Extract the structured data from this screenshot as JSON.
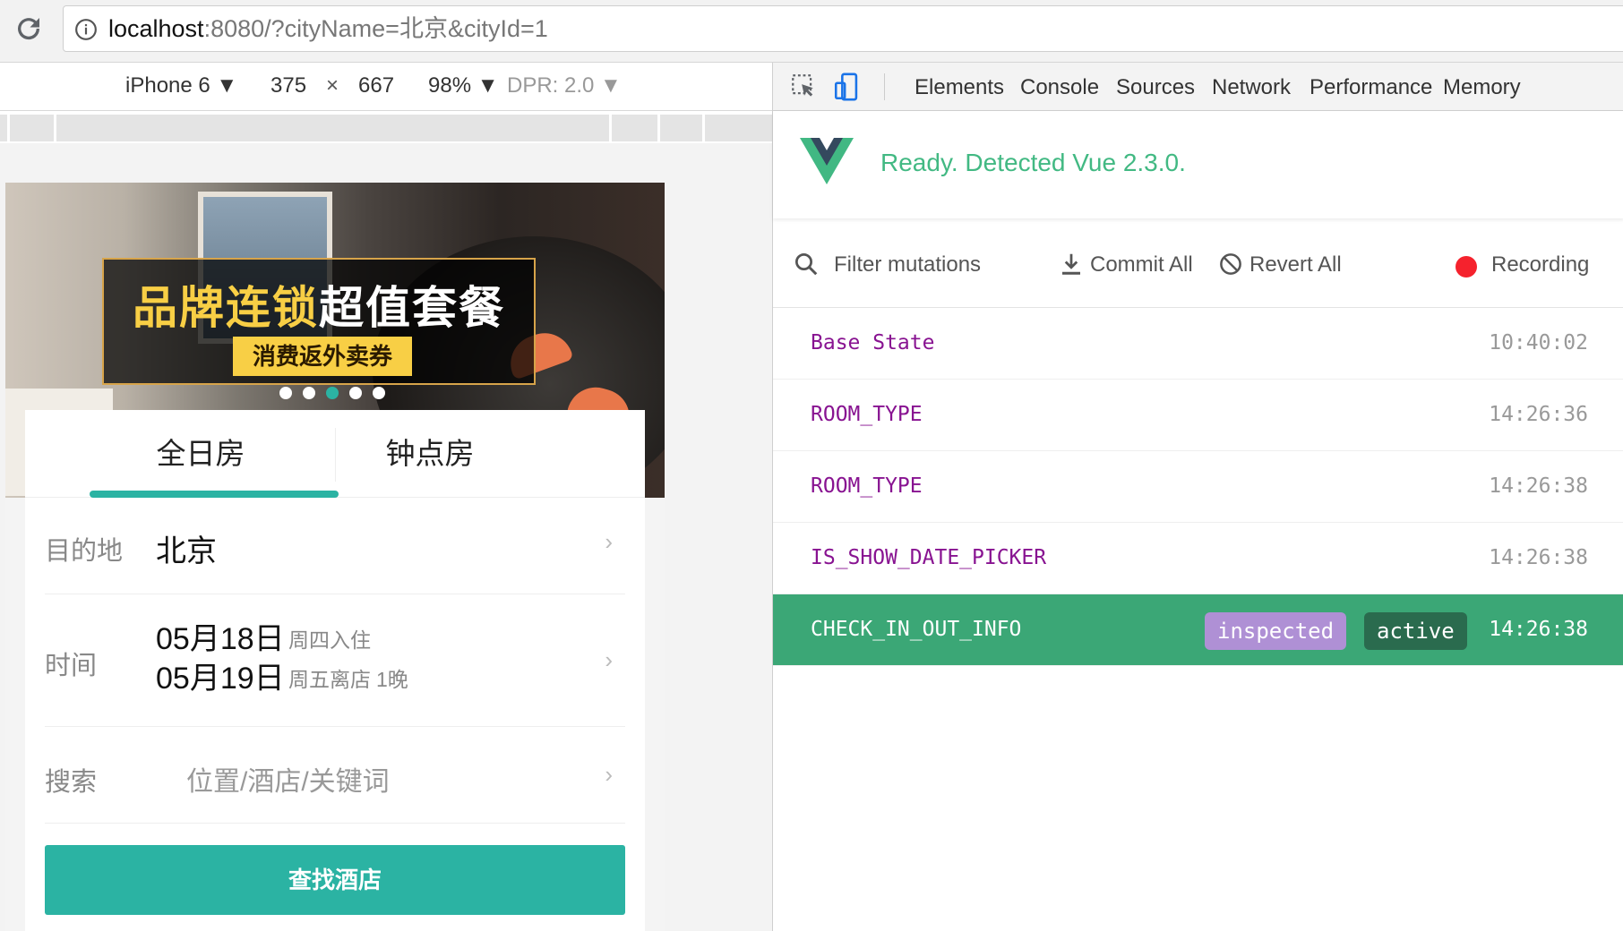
{
  "browser": {
    "url_host": "localhost",
    "url_rest": ":8080/?cityName=北京&cityId=1"
  },
  "device_toolbar": {
    "device": "iPhone 6 ▼",
    "width": "375",
    "times": "×",
    "height": "667",
    "zoom": "98% ▼",
    "dpr": "DPR: 2.0 ▼"
  },
  "app": {
    "banner": {
      "title_gold": "品牌连锁",
      "title_white": "超值套餐",
      "subtitle": "消费返外卖券",
      "active_dot": 3,
      "dot_count": 5
    },
    "tabs": [
      "全日房",
      "钟点房"
    ],
    "destination_label": "目的地",
    "destination_value": "北京",
    "time_label": "时间",
    "checkin_date": "05月18日",
    "checkin_note": "周四入住",
    "checkout_date": "05月19日",
    "checkout_note": "周五离店",
    "nights": "1晚",
    "search_label": "搜索",
    "search_placeholder": "位置/酒店/关键词",
    "search_button": "查找酒店",
    "chevron": "›"
  },
  "devtools": {
    "tabs": [
      "Elements",
      "Console",
      "Sources",
      "Network",
      "Performance",
      "Memory"
    ],
    "vue_status": "Ready. Detected Vue 2.3.0.",
    "filter_placeholder": "Filter mutations",
    "commit_all": "Commit All",
    "revert_all": "Revert All",
    "recording": "Recording",
    "mutations": [
      {
        "name": "Base State",
        "time": "10:40:02"
      },
      {
        "name": "ROOM_TYPE",
        "time": "14:26:36"
      },
      {
        "name": "ROOM_TYPE",
        "time": "14:26:38"
      },
      {
        "name": "IS_SHOW_DATE_PICKER",
        "time": "14:26:38"
      },
      {
        "name": "CHECK_IN_OUT_INFO",
        "time": "14:26:38"
      }
    ],
    "badge_inspected": "inspected",
    "badge_active": "active"
  },
  "colors": {
    "vue_green": "#42b983",
    "selected_row": "#3ba776",
    "teal_button": "#2bb3a3",
    "mutation_name": "#881391",
    "badge_inspected": "#af90d5"
  }
}
